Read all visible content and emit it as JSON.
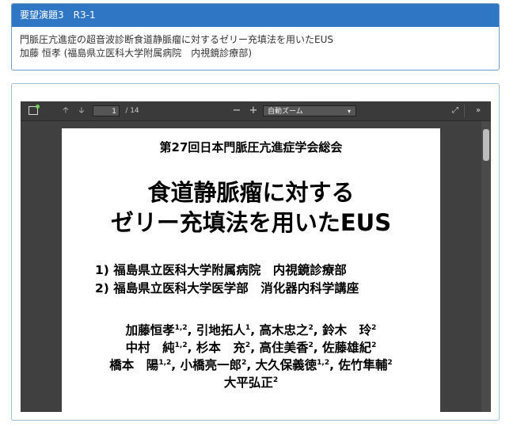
{
  "header": {
    "session_label": "要望演題3　R3-1",
    "presentation_title": "門脈圧亢進症の超音波診断食道静脈瘤に対するゼリー充填法を用いたEUS",
    "presenter": "加藤 恒孝 (福島県立医科大学附属病院　内視鏡診療部)"
  },
  "viewer": {
    "page_number": "1",
    "page_count": "/ 14",
    "zoom_label": "自動ズーム",
    "zoom_out": "−",
    "zoom_in": "+",
    "icons": [
      "sidebar-toggle-icon",
      "arrow-up-icon",
      "arrow-down-icon",
      "chevron-down-icon",
      "fullscreen-icon",
      "double-chevron-right-icon"
    ]
  },
  "slide": {
    "conference": "第27回日本門脈圧亢進症学会総会",
    "title_line1": "食道静脈瘤に対する",
    "title_line2": "ゼリー充填法を用いたEUS",
    "affiliations": [
      "1)  福島県立医科大学附属病院　内視鏡診療部",
      "2)  福島県立医科大学医学部　消化器内科学講座"
    ],
    "authors": [
      {
        "name": "加藤恒孝",
        "sup": "1,2",
        "sep": ", "
      },
      {
        "name": "引地拓人",
        "sup": "1",
        "sep": ", "
      },
      {
        "name": "高木忠之",
        "sup": "2",
        "sep": ", "
      },
      {
        "name": "鈴木　玲",
        "sup": "2",
        "sep": ""
      },
      {
        "name": "中村　純",
        "sup": "1,2",
        "sep": ", "
      },
      {
        "name": "杉本　充",
        "sup": "2",
        "sep": ", "
      },
      {
        "name": "高住美香",
        "sup": "2",
        "sep": ", "
      },
      {
        "name": "佐藤雄紀",
        "sup": "2",
        "sep": ""
      },
      {
        "name": "橋本　陽",
        "sup": "1,2",
        "sep": ", "
      },
      {
        "name": "小橋亮一郎",
        "sup": "2",
        "sep": ", "
      },
      {
        "name": "大久保義徳",
        "sup": "1,2",
        "sep": ", "
      },
      {
        "name": "佐竹隼輔",
        "sup": "2",
        "sep": ""
      },
      {
        "name": "大平弘正",
        "sup": "2",
        "sep": ""
      }
    ]
  },
  "colors": {
    "header_bg": "#2f77c4",
    "viewer_bg": "#404040",
    "toolbar_bg": "#3a3a3a"
  }
}
